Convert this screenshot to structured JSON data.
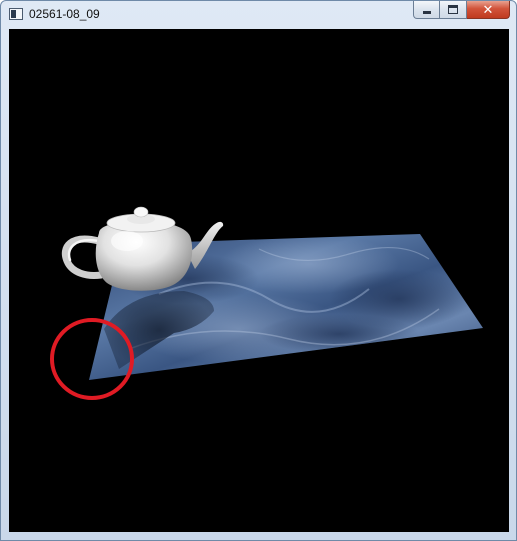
{
  "window": {
    "title": "02561-08_09",
    "close_glyph": "✕"
  },
  "icons": {
    "app": "app-window-icon",
    "minimize": "minimize-icon",
    "maximize": "maximize-icon",
    "close": "close-icon"
  },
  "scene": {
    "background_color": "#000000",
    "floor_color": "#3d5a86",
    "teapot_color": "#e8e8e8",
    "highlight_circle_color": "#e01b24"
  }
}
